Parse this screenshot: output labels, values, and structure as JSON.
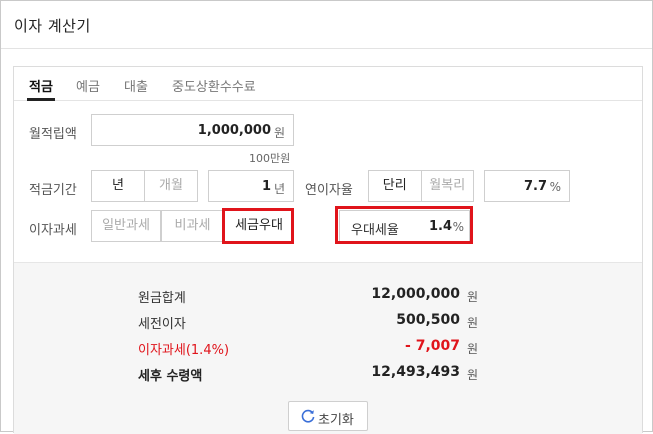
{
  "title": "이자 계산기",
  "tabs": [
    "적금",
    "예금",
    "대출",
    "중도상환수수료"
  ],
  "monthly": {
    "label": "월적립액",
    "value": "1,000,000",
    "unit": "원",
    "hint": "100만원"
  },
  "period": {
    "label": "적금기간",
    "options": [
      "년",
      "개월"
    ],
    "value": "1",
    "unit": "년"
  },
  "rate": {
    "label": "연이자율",
    "options": [
      "단리",
      "월복리"
    ],
    "value": "7.7",
    "unit": "%"
  },
  "tax": {
    "label": "이자과세",
    "options": [
      "일반과세",
      "비과세",
      "세금우대"
    ],
    "pref_label": "우대세율",
    "pref_value": "1.4",
    "pref_unit": "%"
  },
  "results": {
    "principal_label": "원금합계",
    "principal_value": "12,000,000",
    "pretax_label": "세전이자",
    "pretax_value": "500,500",
    "tax_label": "이자과세(1.4%)",
    "tax_value": "- 7,007",
    "net_label": "세후 수령액",
    "net_value": "12,493,493",
    "unit": "원"
  },
  "reset_label": "초기화",
  "colors": {
    "highlight": "#e0141b",
    "negative": "#e0141b"
  }
}
